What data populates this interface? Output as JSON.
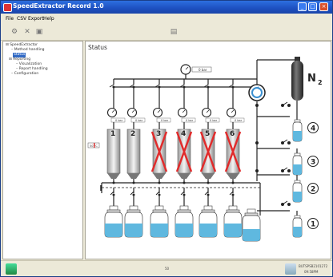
{
  "window": {
    "title": "SpeedExtractor Record 1.0",
    "controls": {
      "minimize": "_",
      "maximize": "□",
      "close": "×"
    }
  },
  "menu": {
    "items": [
      "File",
      "CSV Export",
      "Help"
    ]
  },
  "toolbar": {
    "icons": [
      "gear-icon",
      "close-icon",
      "save-icon",
      "chart-icon"
    ]
  },
  "tree": {
    "items": [
      {
        "label": "SpeedExtractor"
      },
      {
        "label": "Method handling"
      },
      {
        "label": "Status"
      },
      {
        "label": "Reporting"
      },
      {
        "label": "Visualization"
      },
      {
        "label": "Report handling"
      },
      {
        "label": "Configuration"
      }
    ]
  },
  "status": {
    "title": "Status",
    "gas_label": "N",
    "gas_subscript": "2",
    "main_pressure": "0 bar",
    "cell_pressures": [
      "0 bar",
      "0 bar",
      "0 bar",
      "0 bar",
      "0 bar",
      "0 bar"
    ],
    "cells": [
      {
        "number": "1",
        "disabled": false
      },
      {
        "number": "2",
        "disabled": false
      },
      {
        "number": "3",
        "disabled": true
      },
      {
        "number": "4",
        "disabled": true
      },
      {
        "number": "5",
        "disabled": true
      },
      {
        "number": "6",
        "disabled": true
      }
    ],
    "temperature": "50 °C",
    "solvents": [
      "4",
      "3",
      "2",
      "1"
    ]
  },
  "statusbar": {
    "center_text": "50",
    "right_line1": "BUTSPSB2101272",
    "right_line2": "09:58PM"
  },
  "colors": {
    "liquid": "#5fb8df",
    "column_dark": "#7a7a7a",
    "cross_red": "#e12b2b",
    "line": "#222222",
    "cylinder": "#3a3a3a"
  }
}
